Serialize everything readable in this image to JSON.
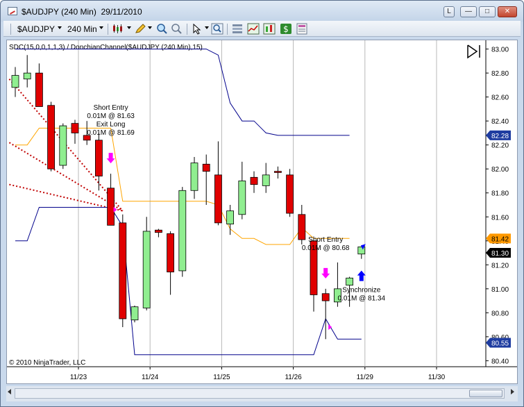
{
  "window": {
    "title": "$AUDJPY (240 Min)  29/11/2010"
  },
  "toolbar": {
    "instrument": "$AUDJPY",
    "interval": "240 Min"
  },
  "icons": {
    "app": "chart-window-icon",
    "bars_type": "candlestick-icon",
    "drawing": "pencil-icon",
    "zoom_in": "zoom-in-icon",
    "zoom_out": "zoom-out-icon",
    "cursor": "pointer-icon",
    "search": "magnifier-icon",
    "properties": "properties-icon",
    "indicators": "indicators-icon",
    "strategies": "strategy-dollar-icon",
    "data_box": "data-box-icon",
    "expand": "expand-panel-icon"
  },
  "colors": {
    "up_candle": "#90ee90",
    "down_candle": "#e00000",
    "donchian": "#00008b",
    "mid": "#ffa500",
    "fan": "#c00000",
    "signal_sell": "#ff00ff",
    "signal_buy": "#0000ff",
    "badge_upper": "#1e3ca0",
    "badge_mid": "#ff9900",
    "badge_price": "#000000"
  },
  "chart_data": {
    "type": "candlestick",
    "title": "SDC(15,0,0,1,1,3) / DonchianChannel($AUDJPY (240 Min),15)",
    "copyright": "© 2010 NinjaTrader, LLC",
    "ylim": [
      80.35,
      83.05
    ],
    "y_ticks": [
      "83.00",
      "82.80",
      "82.60",
      "82.40",
      "82.20",
      "82.00",
      "81.80",
      "81.60",
      "81.40",
      "81.20",
      "81.00",
      "80.80",
      "80.60",
      "80.40"
    ],
    "x_ticks": [
      {
        "label": "11/23",
        "index": 5
      },
      {
        "label": "11/24",
        "index": 11
      },
      {
        "label": "11/25",
        "index": 17
      },
      {
        "label": "11/26",
        "index": 23
      },
      {
        "label": "11/29",
        "index": 29
      },
      {
        "label": "11/30",
        "index": 35
      }
    ],
    "candles": [
      {
        "o": 82.68,
        "h": 82.85,
        "l": 82.6,
        "c": 82.78
      },
      {
        "o": 82.75,
        "h": 82.95,
        "l": 82.68,
        "c": 82.8
      },
      {
        "o": 82.8,
        "h": 82.88,
        "l": 82.55,
        "c": 82.52
      },
      {
        "o": 82.53,
        "h": 82.56,
        "l": 81.98,
        "c": 82.0
      },
      {
        "o": 82.03,
        "h": 82.38,
        "l": 82.0,
        "c": 82.36
      },
      {
        "o": 82.38,
        "h": 82.41,
        "l": 82.21,
        "c": 82.3
      },
      {
        "o": 82.28,
        "h": 82.4,
        "l": 82.2,
        "c": 82.24
      },
      {
        "o": 82.24,
        "h": 82.3,
        "l": 81.82,
        "c": 81.94
      },
      {
        "o": 81.84,
        "h": 81.96,
        "l": 81.55,
        "c": 81.53
      },
      {
        "o": 81.55,
        "h": 81.62,
        "l": 80.68,
        "c": 80.75
      },
      {
        "o": 80.74,
        "h": 80.86,
        "l": 80.72,
        "c": 80.85
      },
      {
        "o": 80.84,
        "h": 81.6,
        "l": 80.82,
        "c": 81.48
      },
      {
        "o": 81.49,
        "h": 81.5,
        "l": 81.43,
        "c": 81.47
      },
      {
        "o": 81.46,
        "h": 81.48,
        "l": 80.95,
        "c": 81.14
      },
      {
        "o": 81.15,
        "h": 81.85,
        "l": 81.1,
        "c": 81.82
      },
      {
        "o": 81.82,
        "h": 82.1,
        "l": 81.75,
        "c": 82.05
      },
      {
        "o": 82.04,
        "h": 82.12,
        "l": 81.7,
        "c": 81.98
      },
      {
        "o": 81.95,
        "h": 82.23,
        "l": 81.53,
        "c": 81.55
      },
      {
        "o": 81.54,
        "h": 81.7,
        "l": 81.45,
        "c": 81.65
      },
      {
        "o": 81.62,
        "h": 82.06,
        "l": 81.58,
        "c": 81.9
      },
      {
        "o": 81.93,
        "h": 81.98,
        "l": 81.8,
        "c": 81.87
      },
      {
        "o": 81.86,
        "h": 82.05,
        "l": 81.8,
        "c": 81.95
      },
      {
        "o": 81.98,
        "h": 82.02,
        "l": 81.92,
        "c": 81.97
      },
      {
        "o": 81.95,
        "h": 82.0,
        "l": 81.6,
        "c": 81.63
      },
      {
        "o": 81.62,
        "h": 81.7,
        "l": 81.37,
        "c": 81.41
      },
      {
        "o": 81.4,
        "h": 81.41,
        "l": 80.81,
        "c": 80.95
      },
      {
        "o": 80.96,
        "h": 81.0,
        "l": 80.58,
        "c": 80.9
      },
      {
        "o": 80.89,
        "h": 81.22,
        "l": 80.85,
        "c": 81.0
      },
      {
        "o": 81.03,
        "h": 81.1,
        "l": 80.85,
        "c": 81.09
      },
      {
        "o": 81.29,
        "h": 81.35,
        "l": 81.25,
        "c": 81.35
      }
    ],
    "series": [
      {
        "name": "DonchianChannel Upper",
        "values": [
          83.0,
          83.0,
          83.0,
          83.0,
          83.0,
          83.0,
          83.0,
          83.0,
          83.0,
          83.0,
          83.0,
          83.0,
          83.0,
          83.0,
          83.0,
          83.0,
          83.0,
          82.95,
          82.55,
          82.4,
          82.4,
          82.3,
          82.28,
          82.28,
          82.28,
          82.28,
          82.28,
          82.28,
          82.28,
          null
        ]
      },
      {
        "name": "DonchianChannel Lower",
        "values": [
          81.4,
          81.4,
          81.68,
          81.68,
          81.68,
          81.68,
          81.68,
          81.68,
          81.68,
          81.52,
          80.45,
          80.45,
          80.45,
          80.45,
          80.45,
          80.45,
          80.45,
          80.45,
          80.45,
          80.45,
          80.45,
          80.45,
          80.45,
          80.45,
          80.45,
          80.45,
          80.75,
          80.58,
          80.58,
          80.58,
          null
        ]
      },
      {
        "name": "DonchianChannel Mean",
        "values": [
          82.2,
          82.2,
          82.34,
          82.34,
          82.34,
          82.34,
          82.34,
          82.34,
          82.34,
          81.73,
          81.73,
          81.73,
          81.73,
          81.73,
          81.73,
          81.73,
          81.73,
          81.7,
          81.5,
          81.42,
          81.42,
          81.37,
          81.37,
          81.37,
          81.51,
          81.42,
          81.42,
          81.42,
          81.42,
          null
        ]
      }
    ],
    "fan_lines": [
      {
        "from": [
          -0.5,
          82.75
        ],
        "to": [
          9.0,
          81.65
        ]
      },
      {
        "from": [
          -0.5,
          82.22
        ],
        "to": [
          9.0,
          81.65
        ]
      },
      {
        "from": [
          -0.5,
          81.87
        ],
        "to": [
          9.0,
          81.65
        ]
      }
    ],
    "signals": [
      {
        "index": 8,
        "kind": "sell",
        "label_lines": [
          "Short Entry",
          "0.01M @ 81.63",
          "Exit Long",
          "0.01M @ 81.69"
        ]
      },
      {
        "index": 26,
        "kind": "sell",
        "label_lines": [
          "Short Entry",
          "0.01M @ 80.68"
        ]
      },
      {
        "index": 29,
        "kind": "buy",
        "label_lines": [
          "Synchronize",
          "0.01M @ 81.34"
        ]
      }
    ],
    "price_badges": [
      {
        "value": "82.28",
        "role": "upper"
      },
      {
        "value": "81.42",
        "role": "mid"
      },
      {
        "value": "81.30",
        "role": "price"
      },
      {
        "value": "80.55",
        "role": "lower"
      }
    ]
  }
}
